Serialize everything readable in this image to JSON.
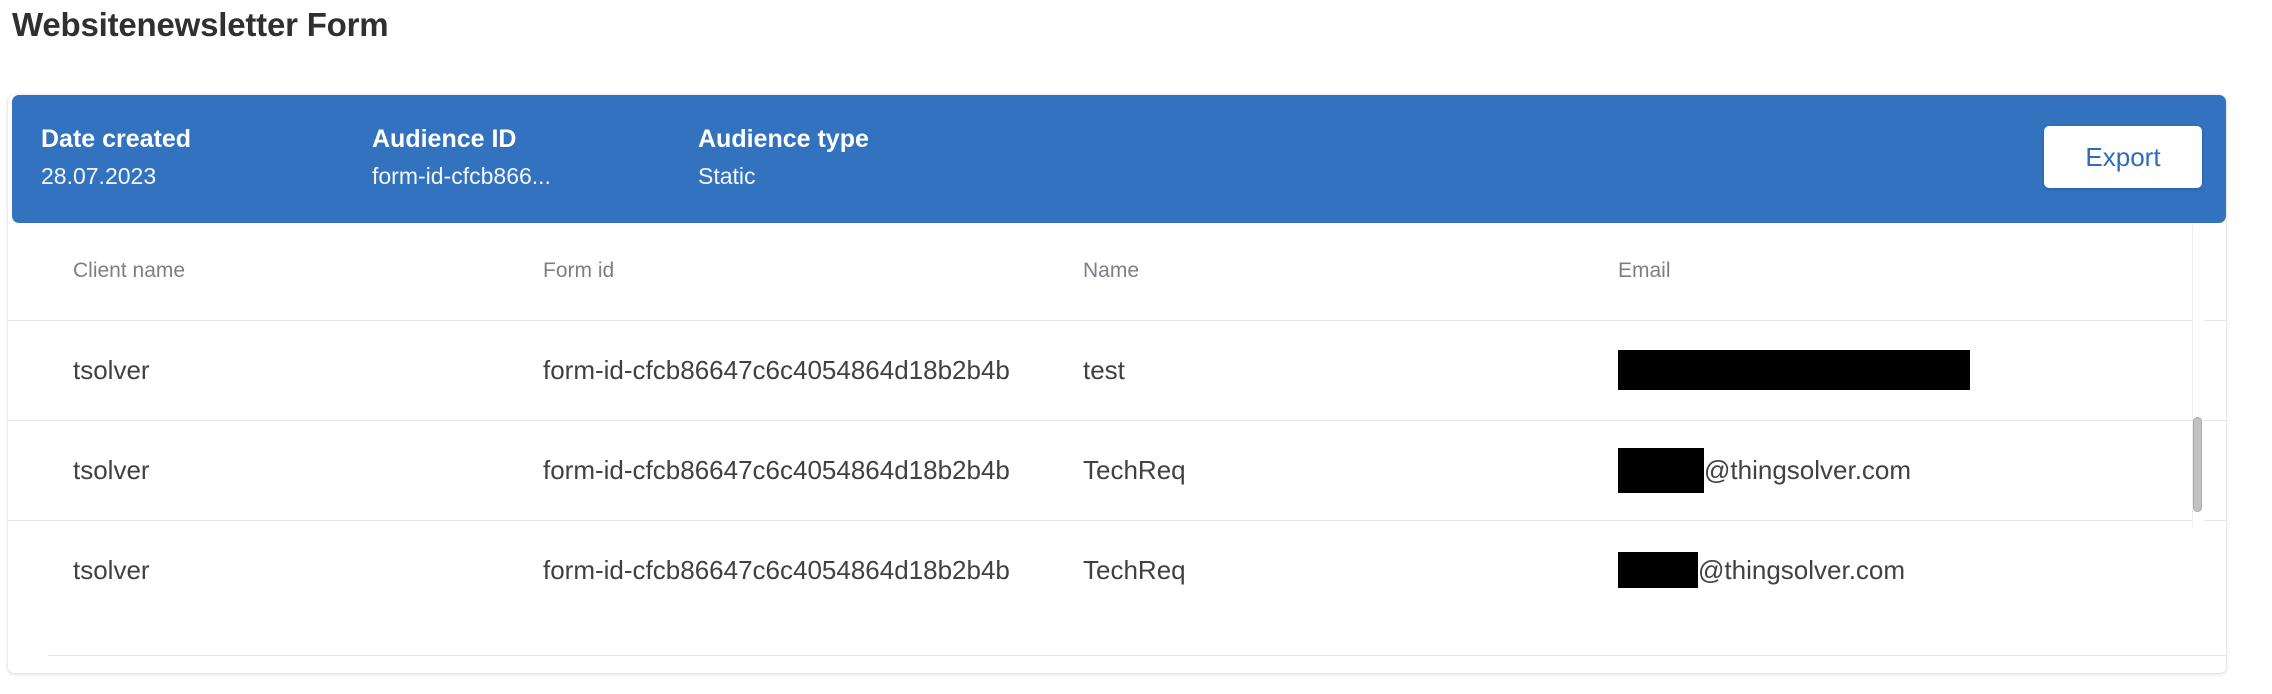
{
  "page_title": "Websitenewsletter Form",
  "summary": {
    "date_created_label": "Date created",
    "date_created_value": "28.07.2023",
    "audience_id_label": "Audience ID",
    "audience_id_value": "form-id-cfcb866...",
    "audience_type_label": "Audience type",
    "audience_type_value": "Static",
    "export_label": "Export",
    "bar_color": "#3272bf",
    "export_text_color": "#2d6cb8"
  },
  "table": {
    "columns": [
      {
        "key": "client_name",
        "label": "Client name"
      },
      {
        "key": "form_id",
        "label": "Form id"
      },
      {
        "key": "name",
        "label": "Name"
      },
      {
        "key": "email",
        "label": "Email"
      }
    ],
    "rows": [
      {
        "client_name": "tsolver",
        "form_id": "form-id-cfcb86647c6c4054864d18b2b4b",
        "name": "test",
        "email_redacted_full": true,
        "email_domain": ""
      },
      {
        "client_name": "tsolver",
        "form_id": "form-id-cfcb86647c6c4054864d18b2b4b",
        "name": "TechReq",
        "email_redacted_full": false,
        "email_domain": "@thingsolver.com"
      },
      {
        "client_name": "tsolver",
        "form_id": "form-id-cfcb86647c6c4054864d18b2b4b",
        "name": "TechReq",
        "email_redacted_full": false,
        "email_domain": "@thingsolver.com"
      }
    ]
  },
  "scrollbar": {
    "orientation": "vertical",
    "thumb_position": "top"
  }
}
